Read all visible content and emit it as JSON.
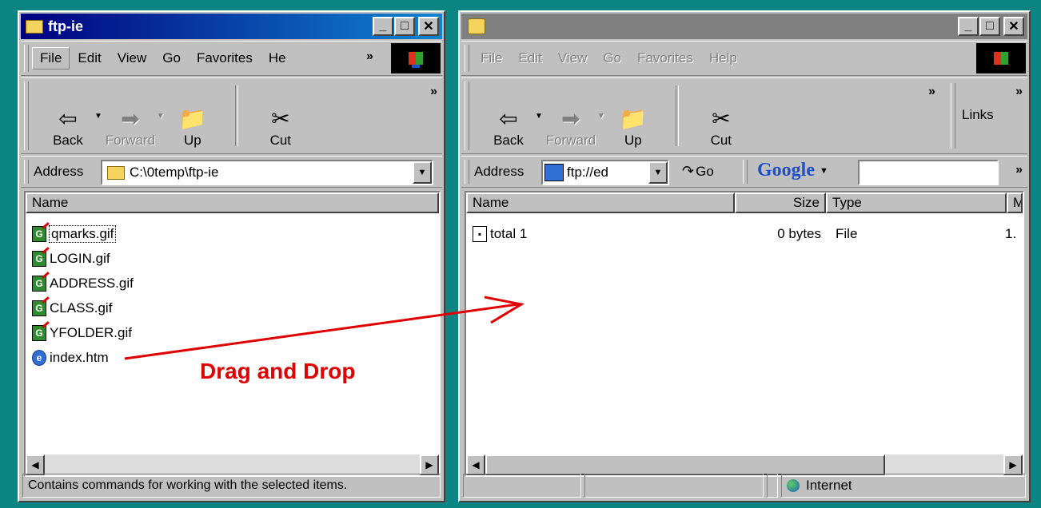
{
  "left": {
    "title": "ftp-ie",
    "menu": [
      "File",
      "Edit",
      "View",
      "Go",
      "Favorites",
      "He"
    ],
    "toolbar": {
      "back": "Back",
      "forward": "Forward",
      "up": "Up",
      "cut": "Cut"
    },
    "address": {
      "label": "Address",
      "value": "C:\\0temp\\ftp-ie"
    },
    "columns": {
      "name": "Name"
    },
    "files": [
      {
        "name": "qmarks.gif",
        "icon": "gif-file-icon"
      },
      {
        "name": "LOGIN.gif",
        "icon": "gif-file-icon"
      },
      {
        "name": "ADDRESS.gif",
        "icon": "gif-file-icon"
      },
      {
        "name": "CLASS.gif",
        "icon": "gif-file-icon"
      },
      {
        "name": "YFOLDER.gif",
        "icon": "gif-file-icon"
      },
      {
        "name": "index.htm",
        "icon": "ie-document-icon"
      }
    ],
    "status": "Contains commands for working with the selected items."
  },
  "right": {
    "menu": [
      "File",
      "Edit",
      "View",
      "Go",
      "Favorites",
      "Help"
    ],
    "toolbar": {
      "back": "Back",
      "forward": "Forward",
      "up": "Up",
      "cut": "Cut",
      "links": "Links"
    },
    "address": {
      "label": "Address",
      "value": "ftp://ed",
      "go": "Go"
    },
    "google": {
      "logo": "Google"
    },
    "columns": {
      "name": "Name",
      "size": "Size",
      "type": "Type",
      "modified": "M"
    },
    "files": [
      {
        "name": "total 1",
        "size": "0 bytes",
        "type": "File",
        "modified": "1."
      }
    ],
    "status": {
      "zone": "Internet"
    }
  },
  "annotation": {
    "text": "Drag and Drop",
    "color": "#e00000"
  },
  "colors": {
    "desktop": "#0b8484",
    "title_active": "#000080",
    "title_inactive": "#808080"
  }
}
